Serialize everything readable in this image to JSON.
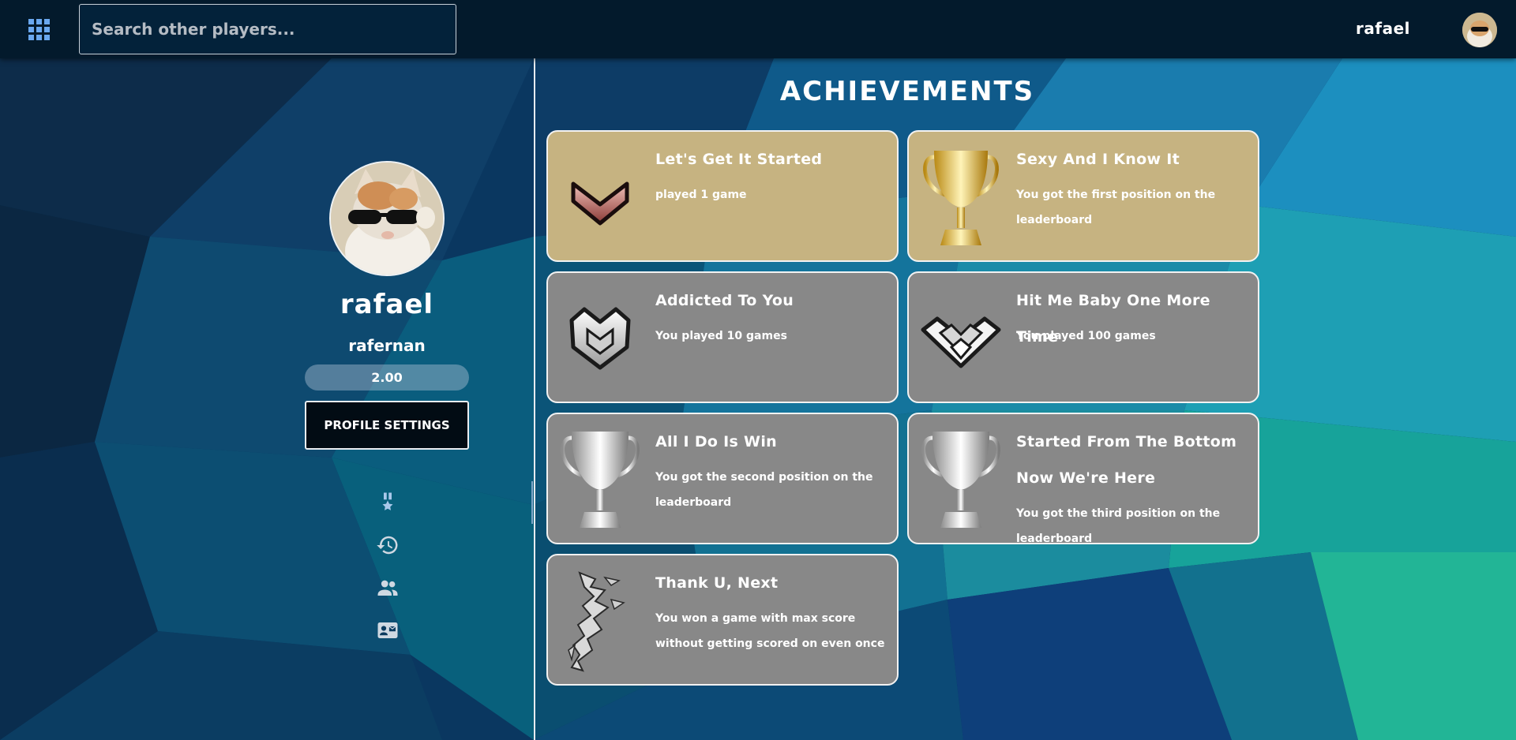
{
  "header": {
    "search_placeholder": "Search other players...",
    "username": "rafael",
    "avatar_alt": "rafael avatar"
  },
  "profile": {
    "display_name": "rafael",
    "login": "rafernan",
    "rating": "2.00",
    "settings_label": "PROFILE SETTINGS"
  },
  "nav": {
    "items": [
      {
        "icon": "medal-icon"
      },
      {
        "icon": "history-icon"
      },
      {
        "icon": "friends-icon"
      },
      {
        "icon": "contact-card-icon"
      }
    ]
  },
  "achievements": {
    "title": "ACHIEVEMENTS",
    "items": [
      {
        "title": "Let's Get It Started",
        "description": "played 1 game",
        "icon": "bronze-chevron-icon",
        "unlocked": true,
        "color": "#c6b381"
      },
      {
        "title": "Sexy And I Know It",
        "description": "You got the first position on the leaderboard",
        "icon": "gold-trophy-icon",
        "unlocked": true,
        "color": "#c6b381"
      },
      {
        "title": "Addicted To You",
        "description": "You played 10 games",
        "icon": "silver-shield-icon",
        "unlocked": false,
        "color": "#888888"
      },
      {
        "title": "Hit Me Baby One More Time",
        "description": "You played 100 games",
        "icon": "winged-rank-icon",
        "unlocked": false,
        "color": "#888888"
      },
      {
        "title": "All I Do Is Win",
        "description": "You got the second position on the leaderboard",
        "icon": "silver-trophy-icon",
        "unlocked": false,
        "color": "#888888"
      },
      {
        "title": "Started From The Bottom Now We're Here",
        "description": "You got the third position on the leaderboard",
        "icon": "silver-trophy-icon",
        "unlocked": false,
        "color": "#888888"
      },
      {
        "title": "Thank U, Next",
        "description": "You won a game with max score without getting scored on even once",
        "icon": "shattered-icon",
        "unlocked": false,
        "color": "#888888"
      }
    ]
  }
}
